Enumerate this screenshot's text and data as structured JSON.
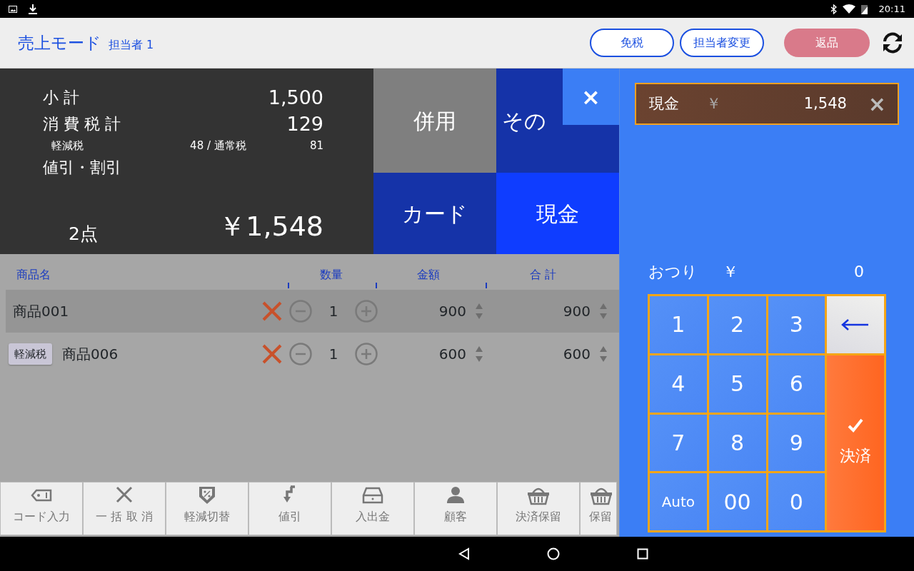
{
  "status_bar": {
    "time": "20:11"
  },
  "header": {
    "title": "売上モード",
    "staff": "担当者 1",
    "buttons": [
      {
        "label": "免税",
        "kind": "outline"
      },
      {
        "label": "担当者変更",
        "kind": "outline"
      },
      {
        "label": "返品",
        "kind": "filled"
      }
    ]
  },
  "summary": {
    "lines": [
      {
        "label": "小 計",
        "value": "1,500"
      },
      {
        "label": "消 費 税 計",
        "value": "129"
      }
    ],
    "tax_breakdown": {
      "reduced_label": "軽減税",
      "middle": "48 / 通常税",
      "standard_value": "81"
    },
    "discount_label": "値引・割引",
    "count": "2点",
    "total": "￥1,548"
  },
  "payment_methods": [
    {
      "label": "併用",
      "kind": "combo"
    },
    {
      "label": "その",
      "kind": "other"
    },
    {
      "label": "カード",
      "kind": "card"
    },
    {
      "label": "現金",
      "kind": "cash"
    }
  ],
  "close_overlay": {
    "label": "×"
  },
  "table": {
    "columns": [
      "商品名",
      "数量",
      "金額",
      "合 計"
    ],
    "rows": [
      {
        "name": "商品001",
        "badge": "",
        "qty": "1",
        "amount": "900",
        "total": "900",
        "selected": true
      },
      {
        "name": "商品006",
        "badge": "軽減税",
        "qty": "1",
        "amount": "600",
        "total": "600",
        "selected": false
      }
    ]
  },
  "toolbar": [
    "コード入力",
    "一 括 取 消",
    "軽減切替",
    "値引",
    "入出金",
    "顧客",
    "決済保留",
    "保留"
  ],
  "payment_entry": {
    "label": "現金",
    "currency": "￥",
    "amount": "1,548",
    "remove": "×"
  },
  "change": {
    "label": "おつり",
    "currency": "￥",
    "amount": "0"
  },
  "keypad": [
    {
      "label": "1",
      "kind": "digit"
    },
    {
      "label": "2",
      "kind": "digit"
    },
    {
      "label": "3",
      "kind": "digit"
    },
    {
      "kind": "back"
    },
    {
      "label": "4",
      "kind": "digit"
    },
    {
      "label": "5",
      "kind": "digit"
    },
    {
      "label": "6",
      "kind": "digit"
    },
    {
      "label": "決済",
      "kind": "settle"
    },
    {
      "label": "7",
      "kind": "digit"
    },
    {
      "label": "8",
      "kind": "digit"
    },
    {
      "label": "9",
      "kind": "digit"
    },
    {
      "label": "Auto",
      "kind": "auto"
    },
    {
      "label": "00",
      "kind": "digit"
    },
    {
      "label": "0",
      "kind": "digit"
    }
  ]
}
